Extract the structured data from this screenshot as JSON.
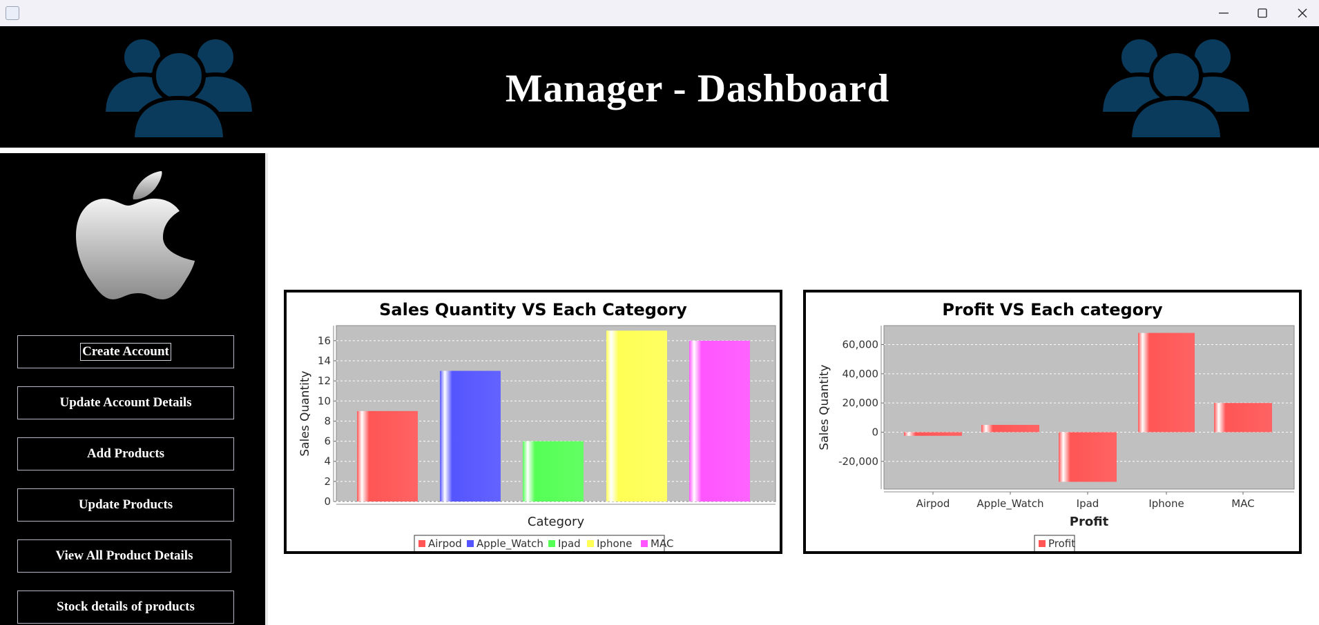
{
  "window": {
    "controls": [
      "minimize-icon",
      "maximize-icon",
      "close-icon"
    ]
  },
  "header": {
    "title": "Manager - Dashboard",
    "icon_left": "users-group-icon",
    "icon_right": "users-group-icon"
  },
  "sidebar": {
    "logo": "apple-logo",
    "buttons": [
      {
        "label": "Create Account",
        "focused": true
      },
      {
        "label": "Update Account Details"
      },
      {
        "label": "Add Products"
      },
      {
        "label": "Update Products"
      },
      {
        "label": "View All Product Details"
      },
      {
        "label": "Stock details of products"
      }
    ]
  },
  "colors": {
    "header_bg": "#000000",
    "icon_blue": "#0a3b5c",
    "plot_bg": "#c0c0c0",
    "airpod": "#ff5555",
    "apple_watch": "#5555ff",
    "ipad": "#55ff55",
    "iphone": "#ffff55",
    "mac": "#ff55ff"
  },
  "chart_data": [
    {
      "type": "bar",
      "title": "Sales Quantity VS Each Category",
      "xlabel": "Category",
      "ylabel": "Sales Quantity",
      "ylim": [
        0,
        17.5
      ],
      "yticks": [
        0,
        2,
        4,
        6,
        8,
        10,
        12,
        14,
        16
      ],
      "grid": true,
      "legend": "bottom",
      "series": [
        {
          "name": "Airpod",
          "color": "#ff5555",
          "values": [
            9
          ]
        },
        {
          "name": "Apple_Watch",
          "color": "#5555ff",
          "values": [
            13
          ]
        },
        {
          "name": "Ipad",
          "color": "#55ff55",
          "values": [
            6
          ]
        },
        {
          "name": "Iphone",
          "color": "#ffff55",
          "values": [
            17
          ]
        },
        {
          "name": "MAC",
          "color": "#ff55ff",
          "values": [
            16
          ]
        }
      ]
    },
    {
      "type": "bar",
      "title": "Profit VS Each category",
      "xlabel": "Profit",
      "ylabel": "Sales Quantity",
      "ylim": [
        -39000,
        73000
      ],
      "yticks": [
        -20000,
        0,
        20000,
        40000,
        60000
      ],
      "ytick_labels": [
        "-20,000",
        "0",
        "20,000",
        "40,000",
        "60,000"
      ],
      "grid": true,
      "legend": "bottom",
      "categories": [
        "Airpod",
        "Apple_Watch",
        "Ipad",
        "Iphone",
        "MAC"
      ],
      "series": [
        {
          "name": "Profit",
          "color": "#ff5555",
          "values": [
            -2500,
            5000,
            -34000,
            68000,
            20000
          ]
        }
      ]
    }
  ]
}
